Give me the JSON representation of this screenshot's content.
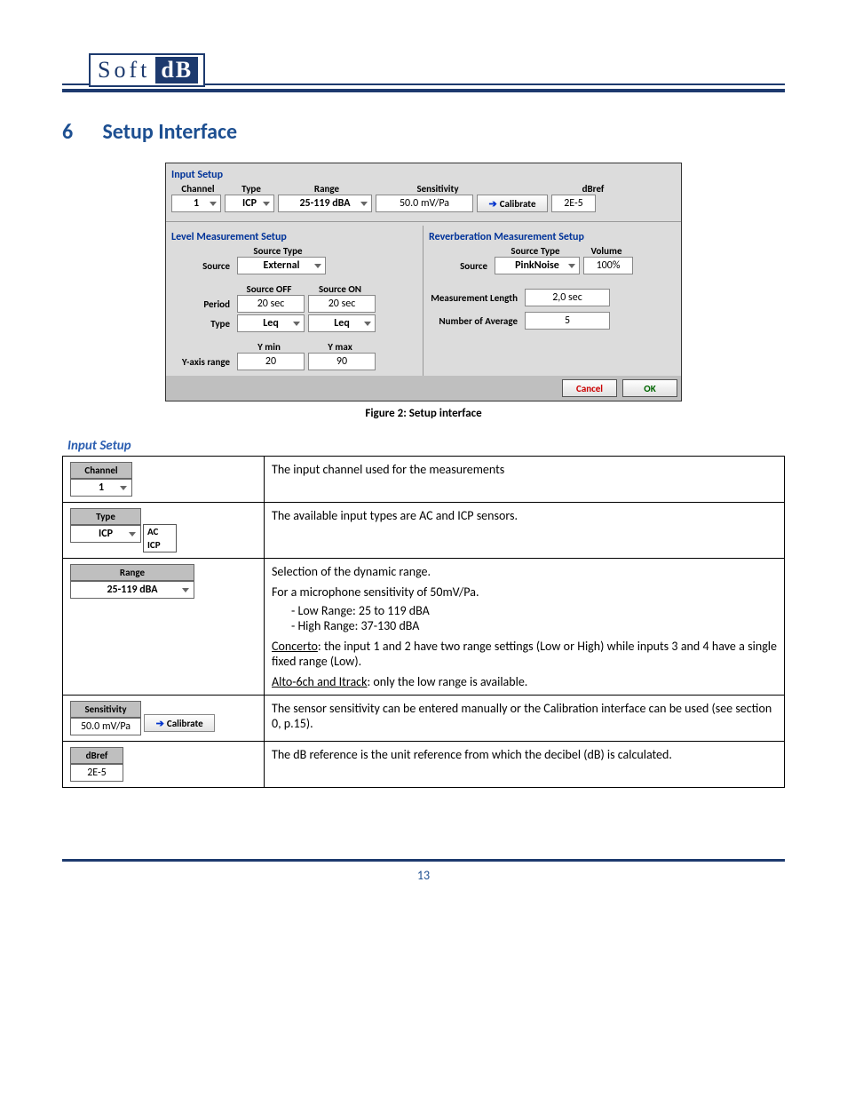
{
  "logo": {
    "soft": "Soft",
    "db": "dB"
  },
  "section": {
    "num": "6",
    "title": "Setup Interface"
  },
  "figure": {
    "caption": "Figure 2: Setup interface",
    "inputSetup": {
      "title": "Input Setup",
      "headers": {
        "channel": "Channel",
        "type": "Type",
        "range": "Range",
        "sensitivity": "Sensitivity",
        "dbref": "dBref"
      },
      "values": {
        "channel": "1",
        "type": "ICP",
        "range": "25-119 dBA",
        "sensitivity": "50.0 mV/Pa",
        "calibrate": "Calibrate",
        "dbref": "2E-5"
      }
    },
    "level": {
      "title": "Level Measurement Setup",
      "sourceTypeLabel": "Source Type",
      "sourceLabel": "Source",
      "source": "External",
      "sourceOffLabel": "Source OFF",
      "sourceOnLabel": "Source ON",
      "periodLabel": "Period",
      "periodOff": "20 sec",
      "periodOn": "20 sec",
      "typeLabel": "Type",
      "typeOff": "Leq",
      "typeOn": "Leq",
      "yaxisLabel": "Y-axis range",
      "yminLabel": "Y min",
      "ymaxLabel": "Y max",
      "ymin": "20",
      "ymax": "90"
    },
    "reverb": {
      "title": "Reverberation Measurement Setup",
      "sourceTypeLabel": "Source Type",
      "volumeLabel": "Volume",
      "sourceLabel": "Source",
      "source": "PinkNoise",
      "volume": "100%",
      "measLenLabel": "Measurement Length",
      "measLen": "2,0 sec",
      "numAvgLabel": "Number of Average",
      "numAvg": "5"
    },
    "buttons": {
      "cancel": "Cancel",
      "ok": "OK"
    }
  },
  "inputSetupHeading": "Input Setup",
  "rows": [
    {
      "hdr": "Channel",
      "field": "1",
      "desc": "The input channel used for the measurements"
    },
    {
      "hdr": "Type",
      "field": "ICP",
      "options": [
        "AC",
        "ICP"
      ],
      "desc": "The available input types are AC and ICP sensors."
    },
    {
      "hdr": "Range",
      "field": "25-119 dBA",
      "desc1": "Selection of the dynamic range.",
      "desc2": "For a microphone sensitivity of 50mV/Pa.",
      "li1": "Low Range: 25 to 119 dBA",
      "li2": "High Range: 37-130 dBA",
      "desc3a": "Concerto",
      "desc3b": ": the input 1 and 2 have two range settings (Low or High) while inputs 3 and 4 have a single fixed range (Low).",
      "desc4a": "Alto-6ch and Itrack",
      "desc4b": ": only the low range is available."
    },
    {
      "hdr": "Sensitivity",
      "field": "50.0 mV/Pa",
      "btn": "Calibrate",
      "desc": "The sensor sensitivity can be entered manually or the Calibration interface can be used (see section 0, p.15)."
    },
    {
      "hdr": "dBref",
      "field": "2E-5",
      "desc": "The dB reference is the unit reference from which the decibel (dB) is calculated."
    }
  ],
  "pageNumber": "13"
}
